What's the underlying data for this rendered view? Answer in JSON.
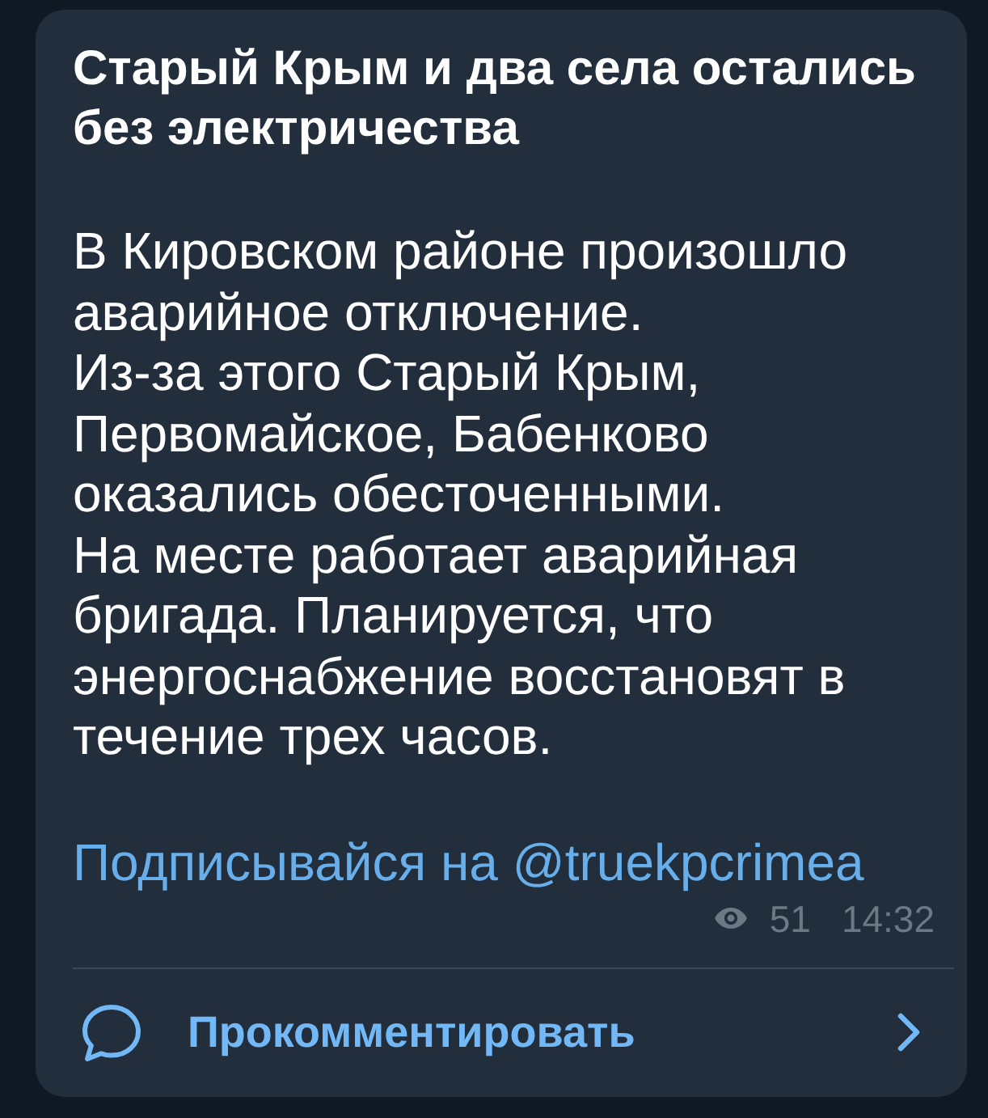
{
  "message": {
    "title": "Старый Крым и два села остались без электричества",
    "paragraphs": [
      "В Кировском районе произошло аварийное отключение.",
      "Из-за этого Старый Крым, Первомайское, Бабенково оказались обесточенными.",
      "На месте работает аварийная бригада. Планируется, что энергоснабжение восстановят в течение трех часов."
    ],
    "link": "Подписывайся на @truekpcrimea",
    "views": "51",
    "time": "14:32"
  },
  "comments": {
    "label": "Прокомментировать"
  }
}
